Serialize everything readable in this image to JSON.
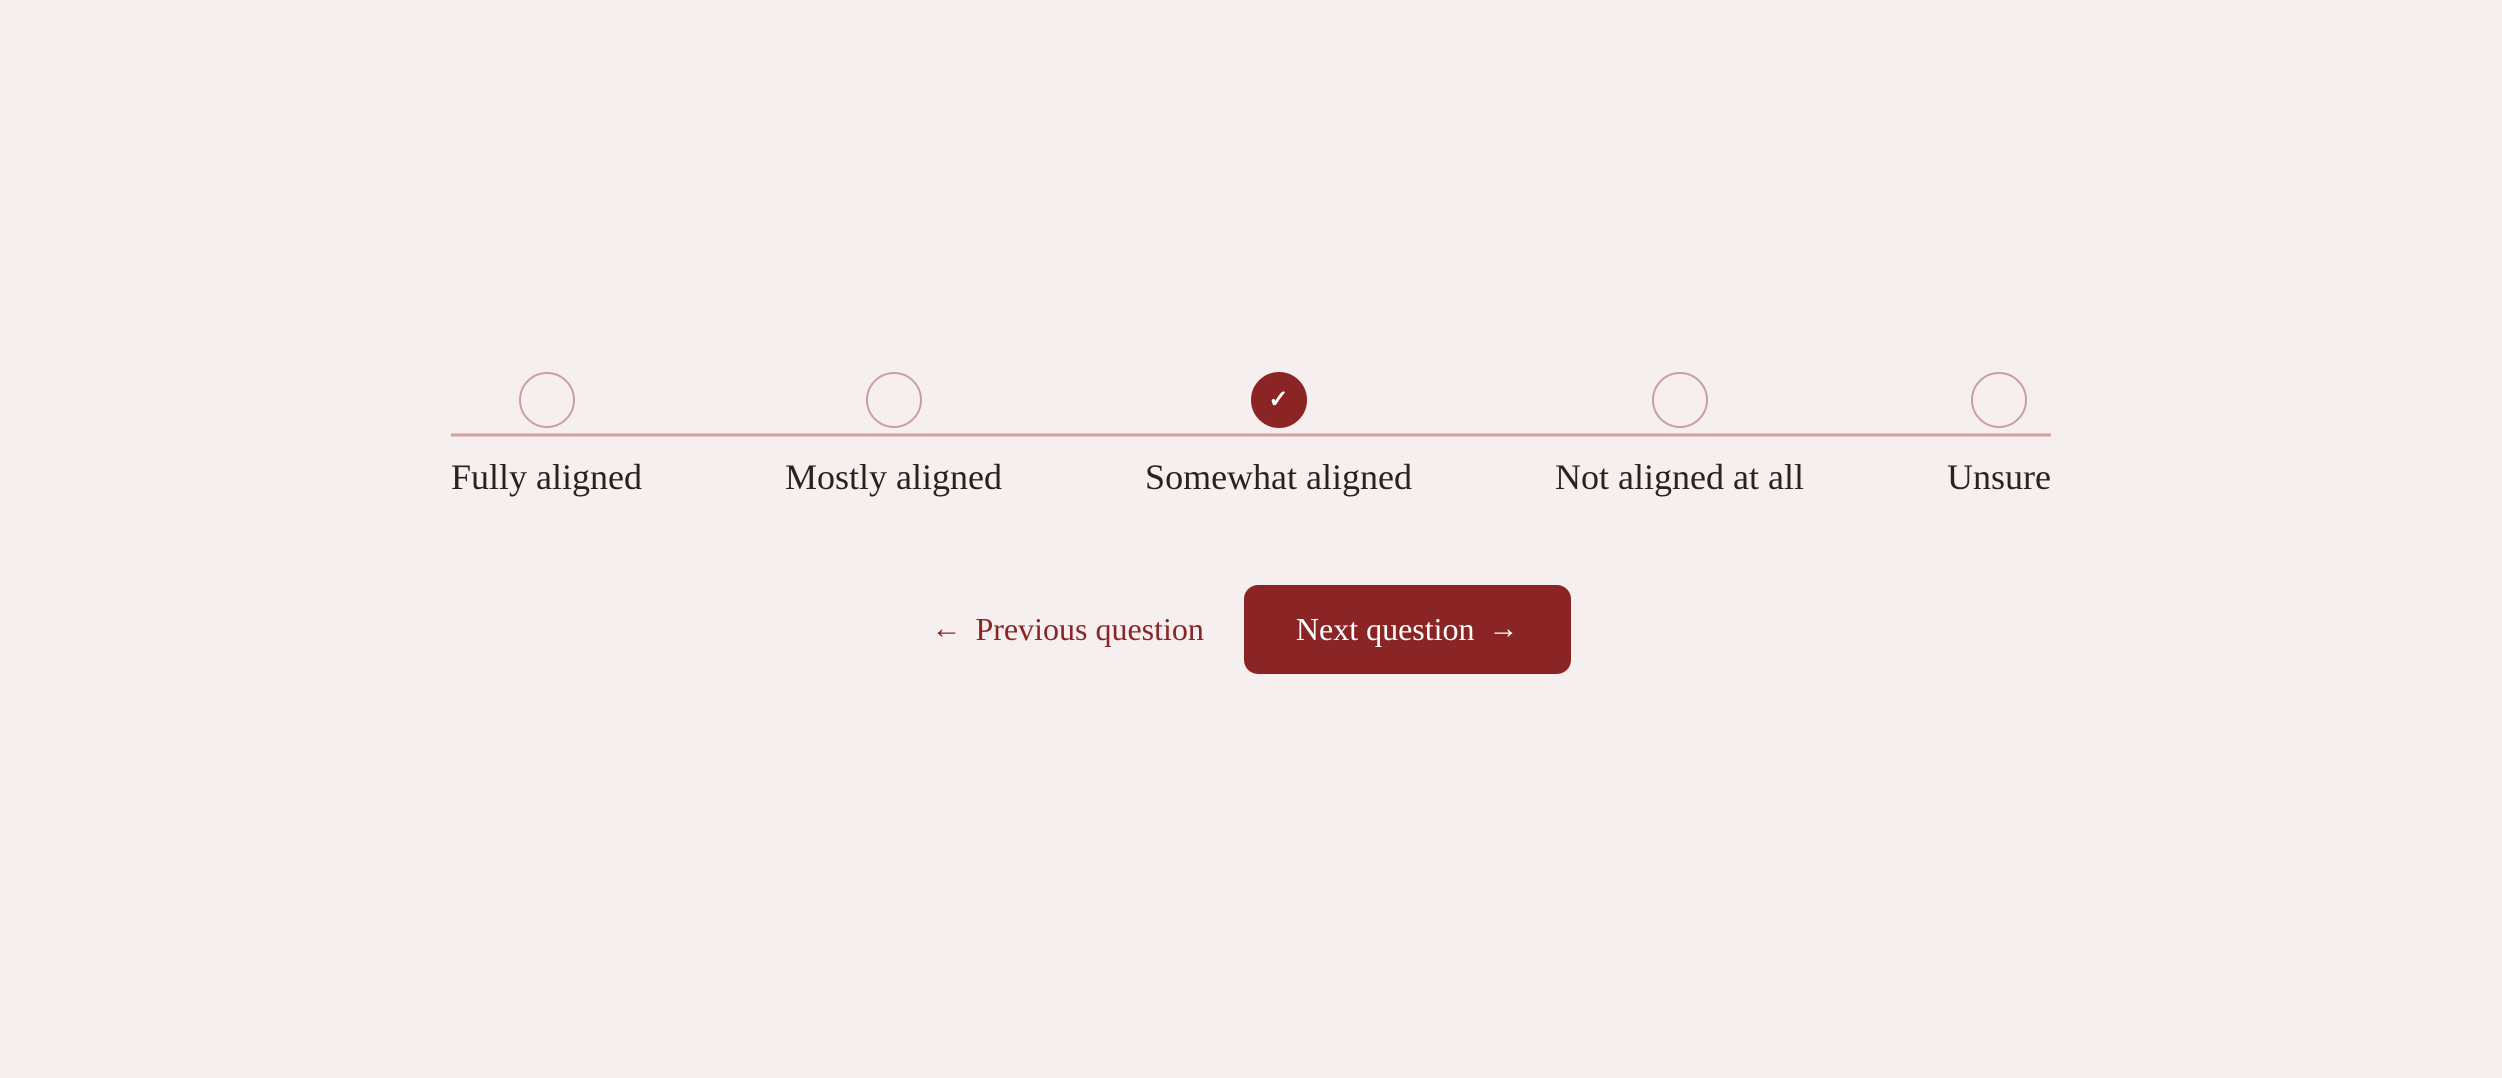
{
  "slider": {
    "options": [
      {
        "id": "fully-aligned",
        "label": "Fully aligned",
        "selected": false
      },
      {
        "id": "mostly-aligned",
        "label": "Mostly aligned",
        "selected": false
      },
      {
        "id": "somewhat-aligned",
        "label": "Somewhat aligned",
        "selected": true
      },
      {
        "id": "not-aligned",
        "label": "Not aligned at all",
        "selected": false
      },
      {
        "id": "unsure",
        "label": "Unsure",
        "selected": false
      }
    ]
  },
  "navigation": {
    "prev_label": "Previous question",
    "next_label": "Next question",
    "prev_arrow": "←",
    "next_arrow": "→"
  },
  "colors": {
    "accent": "#8b2424",
    "track": "#d4a0a0",
    "bg": "#f5f0ef"
  }
}
